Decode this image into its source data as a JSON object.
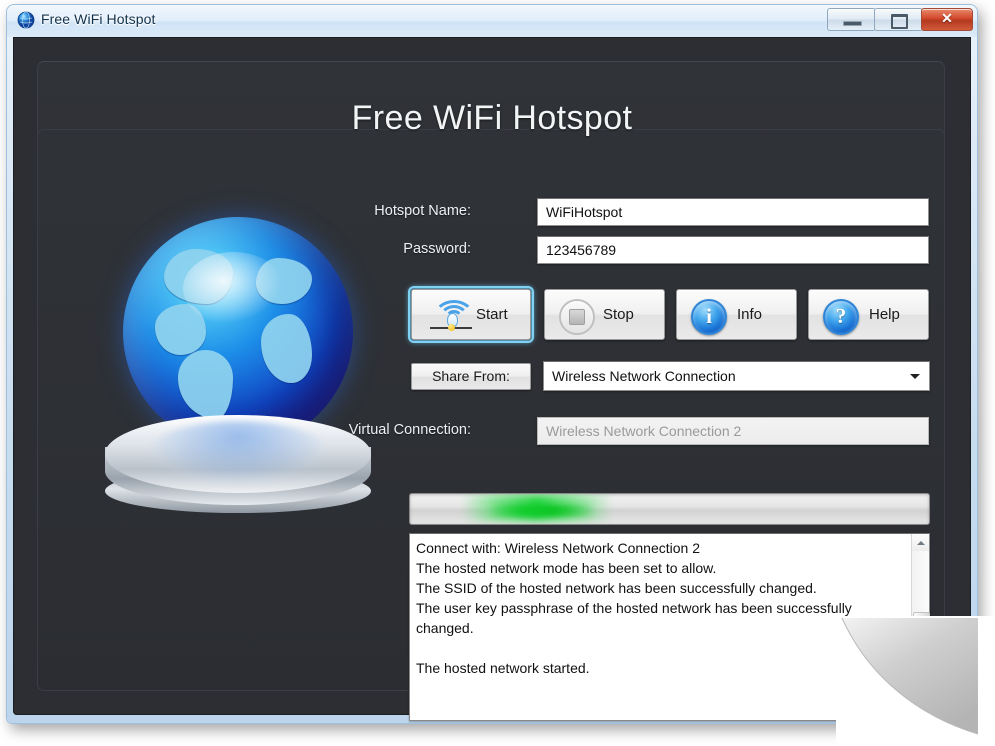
{
  "window": {
    "title": "Free WiFi Hotspot",
    "icon": "globe-icon",
    "controls": {
      "minimize": "–",
      "maximize": "□",
      "close": "✕"
    }
  },
  "app": {
    "heading": "Free WiFi Hotspot",
    "illustration": "globe-on-pedestal"
  },
  "form": {
    "hotspot_name_label": "Hotspot Name:",
    "hotspot_name_value": "WiFiHotspot",
    "password_label": "Password:",
    "password_value": "123456789",
    "share_from_label": "Share From:",
    "share_from_value": "Wireless Network Connection",
    "virtual_connection_label": "Virtual Connection:",
    "virtual_connection_value": "Wireless Network Connection 2"
  },
  "buttons": {
    "start": {
      "label": "Start",
      "icon": "wifi-icon",
      "focused": true
    },
    "stop": {
      "label": "Stop",
      "icon": "stop-icon",
      "enabled": false
    },
    "info": {
      "label": "Info",
      "icon": "info-icon",
      "glyph": "i"
    },
    "help": {
      "label": "Help",
      "icon": "help-icon",
      "glyph": "?"
    }
  },
  "progress": {
    "mode": "marquee",
    "accent_color": "#12cc2c"
  },
  "log": {
    "lines": [
      "Connect with: Wireless Network Connection 2",
      "The hosted network mode has been set to allow.",
      "The SSID of the hosted network has been successfully changed.",
      "The user key passphrase of the hosted network has been successfully changed.",
      "",
      "The hosted network started."
    ],
    "text": "Connect with: Wireless Network Connection 2\nThe hosted network mode has been set to allow.\nThe SSID of the hosted network has been successfully changed.\nThe user key passphrase of the hosted network has been successfully\nchanged.\n\nThe hosted network started."
  },
  "colors": {
    "app_background": "#2c2e33",
    "panel": "#303338",
    "titlebar": "#dceaf8",
    "close_button": "#d2472a",
    "accent_blue": "#1269cf",
    "focus_glow": "#7fd2f2",
    "progress_green": "#12cc2c"
  }
}
